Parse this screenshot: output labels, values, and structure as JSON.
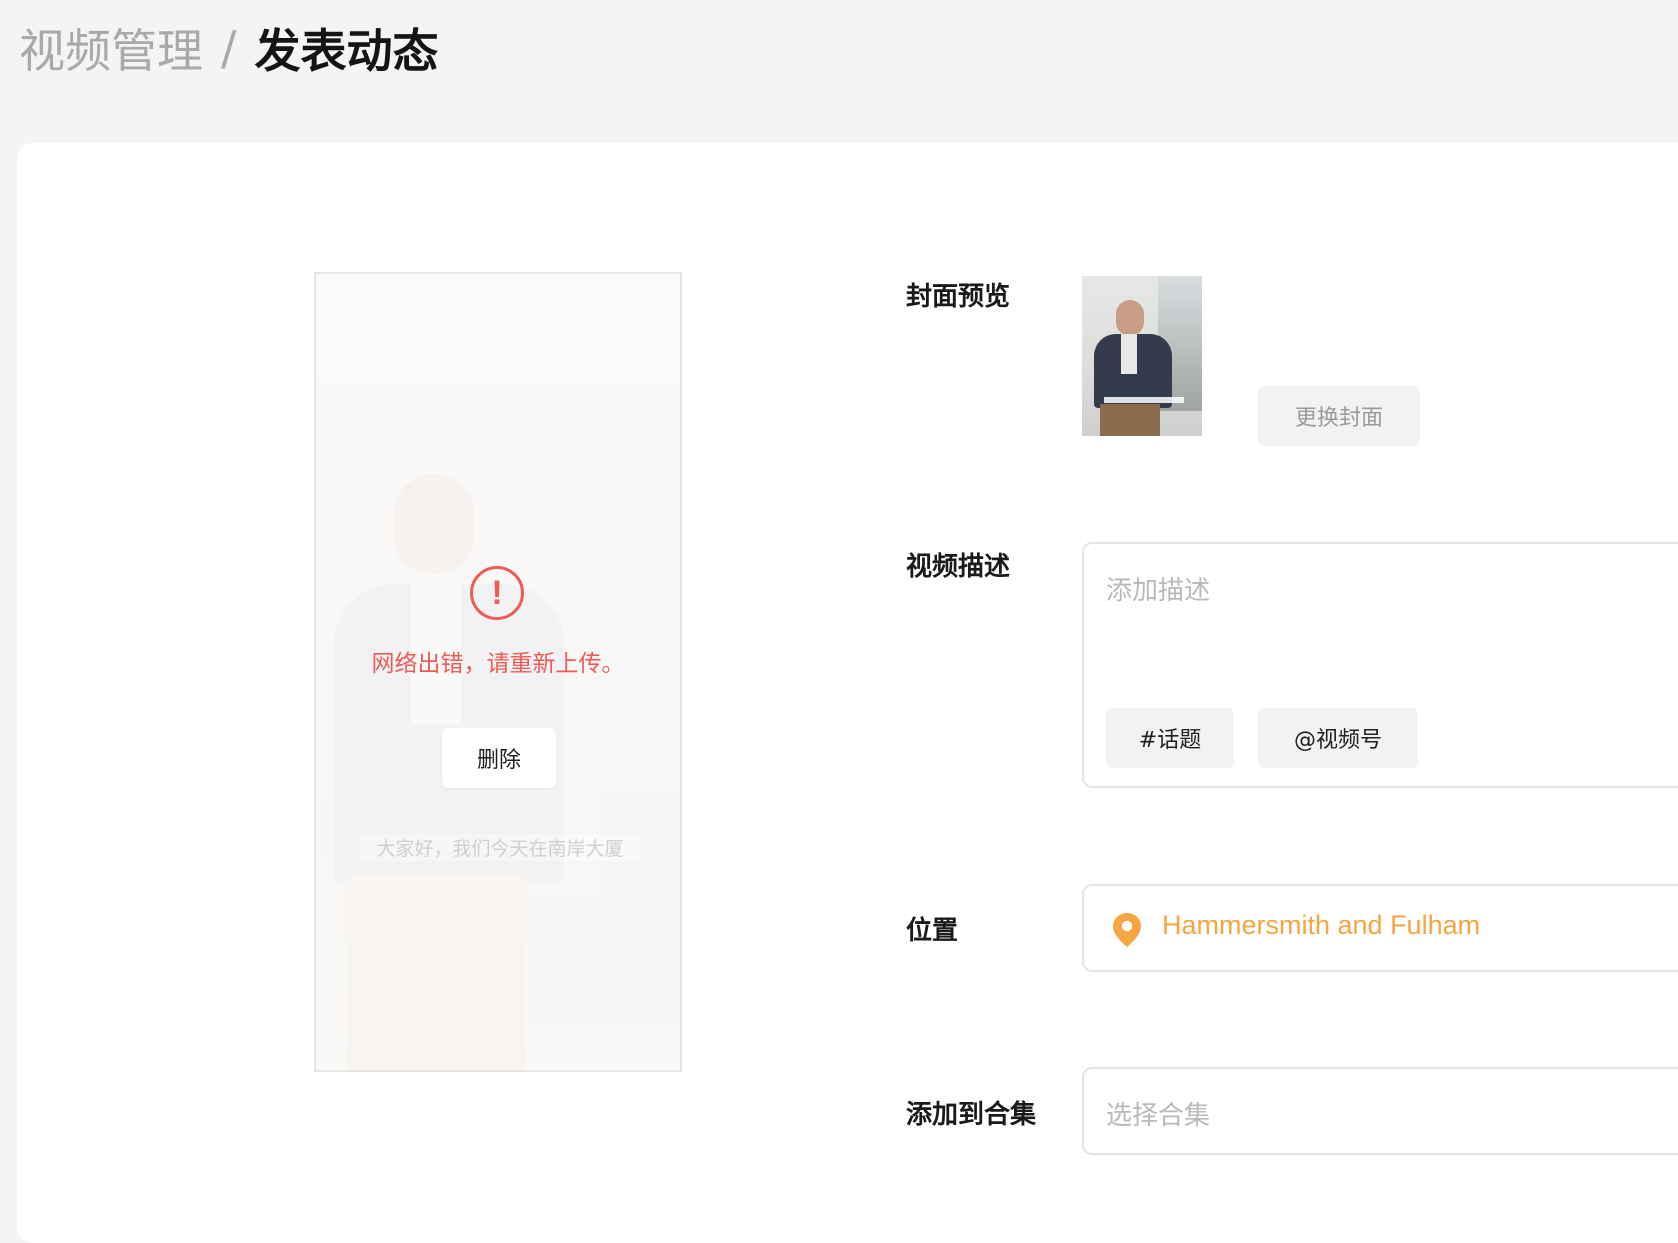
{
  "breadcrumb": {
    "parent": "视频管理",
    "separator": "/",
    "current": "发表动态"
  },
  "video": {
    "error_message": "网络出错，请重新上传。",
    "delete_label": "删除",
    "subtitle": "大家好，我们今天在南岸大厦",
    "error_icon": "exclamation-circle-icon",
    "error_color": "#ee5a55"
  },
  "form": {
    "cover": {
      "label": "封面预览",
      "change_label": "更换封面"
    },
    "description": {
      "label": "视频描述",
      "placeholder": "添加描述",
      "topic_chip": "#话题",
      "mention_chip": "@视频号"
    },
    "location": {
      "label": "位置",
      "value": "Hammersmith and Fulham",
      "icon": "location-pin-icon",
      "color": "#f5a541"
    },
    "collection": {
      "label": "添加到合集",
      "placeholder": "选择合集"
    }
  }
}
